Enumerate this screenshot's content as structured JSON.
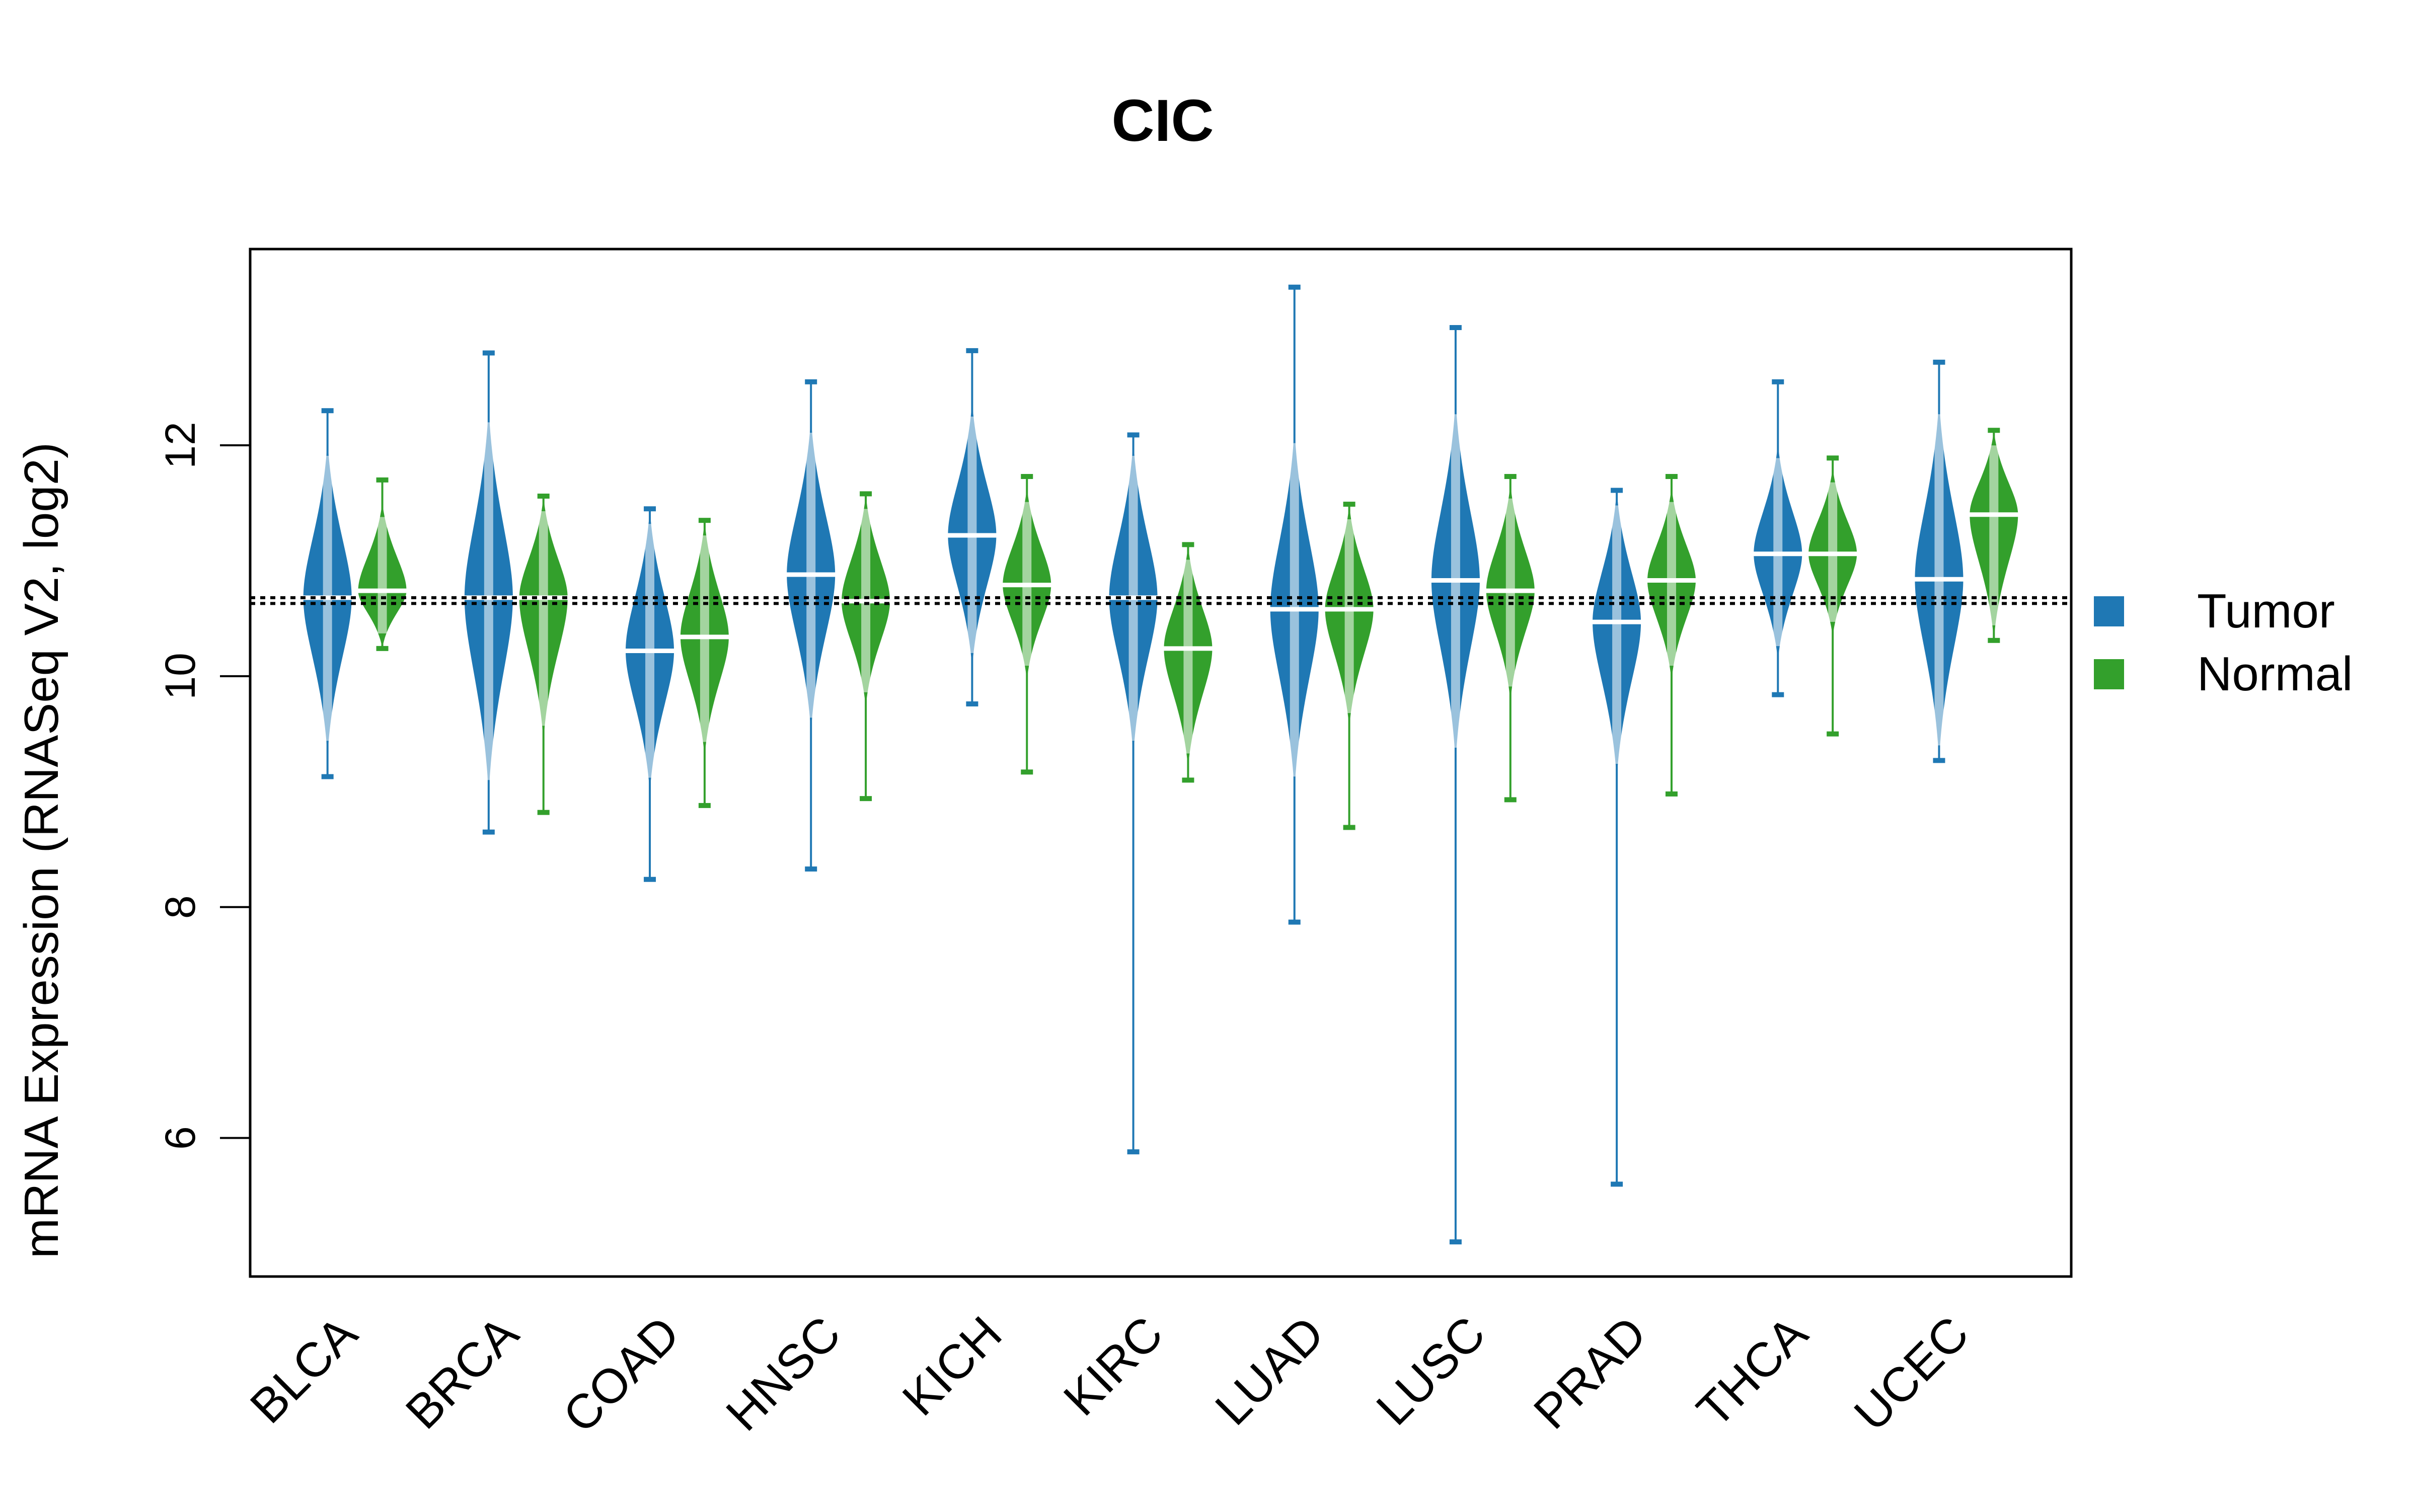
{
  "chart_data": {
    "type": "violin",
    "title": "CIC",
    "xlabel": "",
    "ylabel": "mRNA Expression (RNASeq V2, log2)",
    "ylim": [
      4.8,
      13.7
    ],
    "yticks": [
      6,
      8,
      10,
      12
    ],
    "grid": false,
    "legend_position": "right",
    "reference_lines": [
      10.68,
      10.63
    ],
    "categories": [
      "BLCA",
      "BRCA",
      "COAD",
      "HNSC",
      "KICH",
      "KIRC",
      "LUAD",
      "LUSC",
      "PRAD",
      "THCA",
      "UCEC"
    ],
    "series": [
      {
        "name": "Tumor",
        "color": "#1f78b4",
        "median": [
          10.68,
          10.68,
          10.22,
          10.88,
          11.22,
          10.68,
          10.58,
          10.83,
          10.47,
          11.06,
          10.84
        ],
        "q1": [
          10.35,
          10.25,
          9.95,
          10.55,
          10.95,
          10.35,
          10.2,
          10.45,
          10.15,
          10.85,
          10.45
        ],
        "q3": [
          11.0,
          11.05,
          10.55,
          11.2,
          11.5,
          11.0,
          10.95,
          11.2,
          10.8,
          11.3,
          11.2
        ],
        "min": [
          9.13,
          8.65,
          8.24,
          8.33,
          9.76,
          5.88,
          7.87,
          5.1,
          5.6,
          9.84,
          9.27
        ],
        "max": [
          12.3,
          12.8,
          11.45,
          12.55,
          12.82,
          12.09,
          13.37,
          13.02,
          11.61,
          12.55,
          12.72
        ]
      },
      {
        "name": "Normal",
        "color": "#33a02c",
        "median": [
          10.74,
          10.68,
          10.34,
          10.65,
          10.79,
          10.24,
          10.58,
          10.74,
          10.83,
          11.06,
          11.4
        ],
        "q1": [
          10.6,
          10.4,
          10.1,
          10.45,
          10.6,
          10.0,
          10.35,
          10.5,
          10.6,
          10.9,
          11.1
        ],
        "q3": [
          10.95,
          11.0,
          10.6,
          10.9,
          11.0,
          10.5,
          10.85,
          10.95,
          11.0,
          11.25,
          11.6
        ],
        "min": [
          10.24,
          8.82,
          8.88,
          8.94,
          9.17,
          9.1,
          8.69,
          8.93,
          8.98,
          9.5,
          10.31
        ],
        "max": [
          11.7,
          11.56,
          11.35,
          11.58,
          11.73,
          11.14,
          11.49,
          11.73,
          11.73,
          11.89,
          12.13
        ]
      }
    ]
  }
}
